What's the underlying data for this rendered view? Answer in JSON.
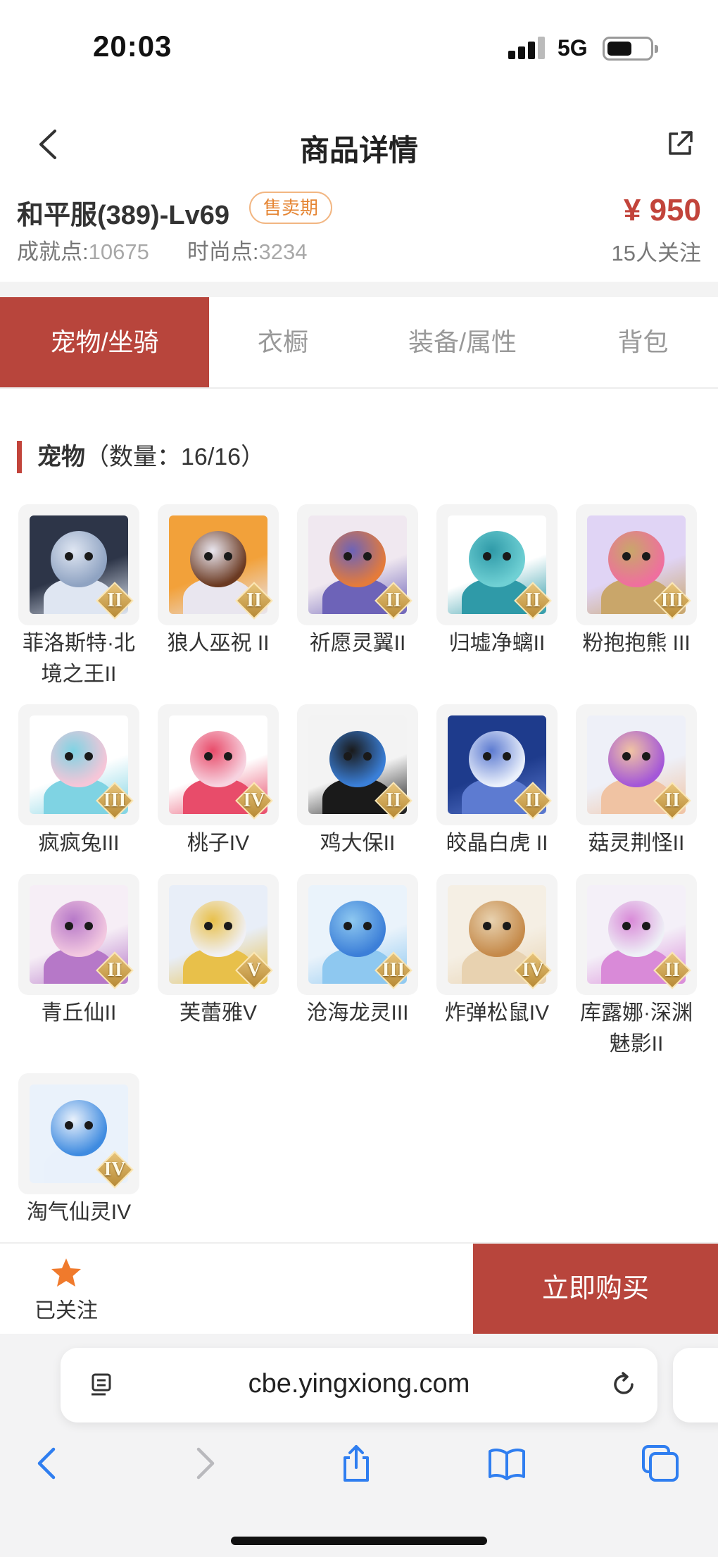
{
  "status_bar": {
    "time": "20:03",
    "network": "5G"
  },
  "nav": {
    "title": "商品详情"
  },
  "product": {
    "name": "和平服(389)-Lv69",
    "status_tag": "售卖期",
    "achievement_label": "成就点:",
    "achievement_value": "10675",
    "fashion_label": "时尚点:",
    "fashion_value": "3234",
    "price": "¥ 950",
    "followers": "15人关注"
  },
  "tabs": [
    {
      "label": "宠物/坐骑",
      "active": true
    },
    {
      "label": "衣橱",
      "active": false
    },
    {
      "label": "装备/属性",
      "active": false
    },
    {
      "label": "背包",
      "active": false
    }
  ],
  "section": {
    "title": "宠物",
    "count_text": "（数量：16/16）"
  },
  "pets": [
    {
      "name": "菲洛斯特·北境之王II",
      "rank": "II",
      "icon": "wolf-king-portrait",
      "colors": [
        "#2d3548",
        "#8fa3c2",
        "#dfe6f2"
      ]
    },
    {
      "name": "狼人巫祝 II",
      "rank": "II",
      "icon": "werewolf-shaman-portrait",
      "colors": [
        "#f2a13a",
        "#6b3a22",
        "#e9e6ef"
      ]
    },
    {
      "name": "祈愿灵翼II",
      "rank": "II",
      "icon": "spirit-bird-portrait",
      "colors": [
        "#f0e8f0",
        "#e57b3a",
        "#6d63b8"
      ]
    },
    {
      "name": "归墟净螭II",
      "rank": "II",
      "icon": "water-dragon-portrait",
      "colors": [
        "#ffffff",
        "#6fd0d4",
        "#2f9aa8"
      ]
    },
    {
      "name": "粉抱抱熊 III",
      "rank": "III",
      "icon": "pink-bear-portrait",
      "colors": [
        "#e0d4f5",
        "#ef6f9e",
        "#c9a66a"
      ]
    },
    {
      "name": "疯疯兔III",
      "rank": "III",
      "icon": "crazy-rabbit-portrait",
      "colors": [
        "#ffffff",
        "#f6c6d8",
        "#7fd3e3"
      ]
    },
    {
      "name": "桃子IV",
      "rank": "IV",
      "icon": "peach-cat-portrait",
      "colors": [
        "#ffffff",
        "#f7d3e0",
        "#e84c6a"
      ]
    },
    {
      "name": "鸡大保II",
      "rank": "II",
      "icon": "blue-bird-portrait",
      "colors": [
        "#f3f3f3",
        "#3a7fd8",
        "#1a1a1a"
      ]
    },
    {
      "name": "皎晶白虎 II",
      "rank": "II",
      "icon": "white-tiger-portrait",
      "colors": [
        "#1e3b8c",
        "#eaf0fb",
        "#5d7bd1"
      ]
    },
    {
      "name": "菇灵荆怪II",
      "rank": "II",
      "icon": "mushroom-spirit-portrait",
      "colors": [
        "#eef0f8",
        "#a457d8",
        "#f0c3a3"
      ]
    },
    {
      "name": "青丘仙II",
      "rank": "II",
      "icon": "fox-fairy-portrait",
      "colors": [
        "#f6eef6",
        "#f2c8e0",
        "#b678c8"
      ]
    },
    {
      "name": "芙蕾雅V",
      "rank": "V",
      "icon": "goddess-portrait",
      "colors": [
        "#e8eef8",
        "#f0f0f5",
        "#e8c04a"
      ]
    },
    {
      "name": "沧海龙灵III",
      "rank": "III",
      "icon": "sea-dragon-spirit-portrait",
      "colors": [
        "#eaf3fb",
        "#3c7fd8",
        "#8ec8f0"
      ]
    },
    {
      "name": "炸弹松鼠IV",
      "rank": "IV",
      "icon": "bomb-squirrel-portrait",
      "colors": [
        "#f5efe4",
        "#c58a4a",
        "#e8d2b0"
      ]
    },
    {
      "name": "库露娜·深渊魅影II",
      "rank": "II",
      "icon": "abyss-phantom-portrait",
      "colors": [
        "#f4f0f8",
        "#eef0f6",
        "#d98ad8"
      ]
    },
    {
      "name": "淘气仙灵IV",
      "rank": "IV",
      "icon": "naughty-spirit-portrait",
      "colors": [
        "#eaf2fb",
        "#3f8be0",
        "#e9f1fb"
      ]
    }
  ],
  "action_bar": {
    "follow_label": "已关注",
    "buy_label": "立即购买"
  },
  "browser": {
    "url": "cbe.yingxiong.com"
  },
  "colors": {
    "accent": "#b8453c",
    "price": "#c2443b",
    "tag": "#e58533",
    "star": "#f07a2c"
  }
}
